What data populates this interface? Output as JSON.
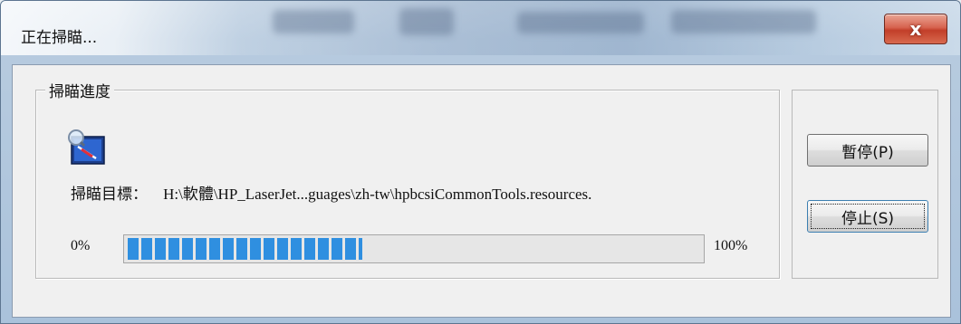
{
  "window": {
    "title": "正在掃瞄...",
    "close_glyph": "x"
  },
  "group": {
    "legend": "掃瞄進度",
    "icon": "scan-magnifier-icon"
  },
  "target": {
    "label": "掃瞄目標：",
    "path": "H:\\軟體\\HP_LaserJet...guages\\zh-tw\\hpbcsiCommonTools.resources."
  },
  "progress": {
    "start_label": "0%",
    "end_label": "100%",
    "value_fraction": 0.41,
    "color": "#2f8fe0"
  },
  "buttons": {
    "pause_label": "暫停(P)",
    "stop_label": "停止(S)"
  }
}
